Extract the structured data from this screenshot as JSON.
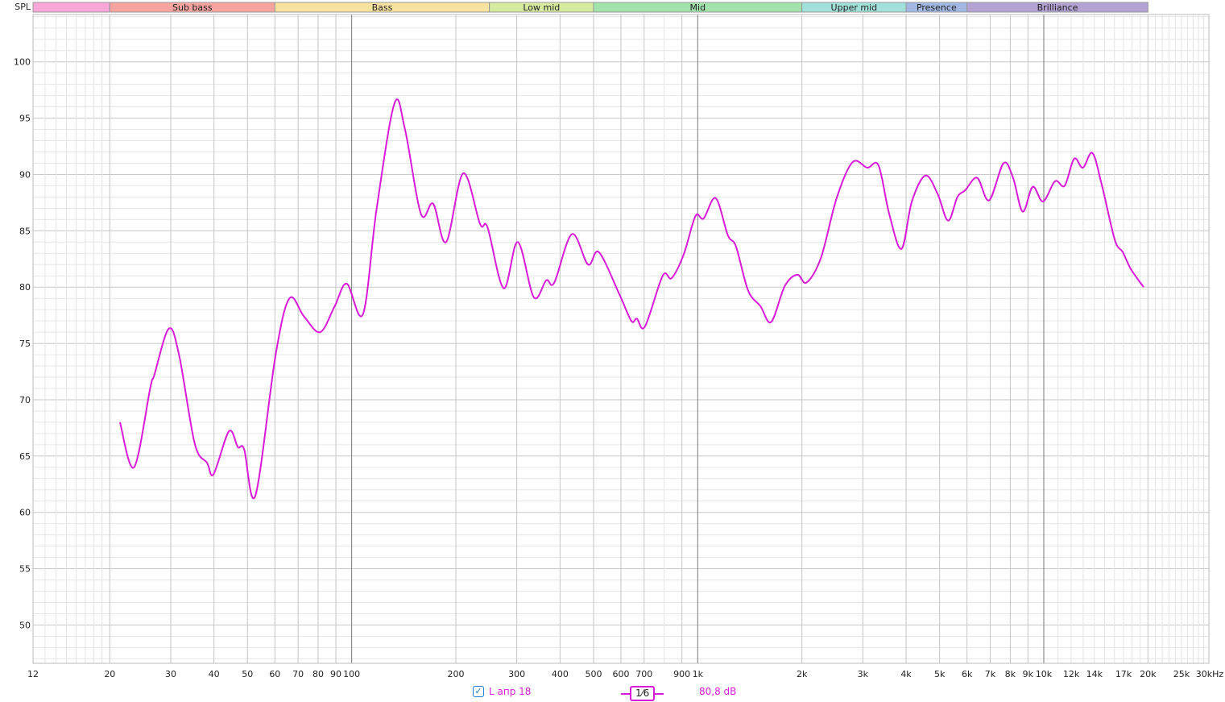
{
  "chart_data": {
    "type": "line",
    "ylabel": "SPL",
    "xscale": "log",
    "xlim": [
      12,
      30000
    ],
    "ylim": [
      46.6,
      104.2
    ],
    "yticks": [
      50,
      55,
      60,
      65,
      70,
      75,
      80,
      85,
      90,
      95,
      100
    ],
    "ygrid_minor_step": 1,
    "xticks": [
      {
        "f": 12,
        "label": "12"
      },
      {
        "f": 20,
        "label": "20"
      },
      {
        "f": 30,
        "label": "30"
      },
      {
        "f": 40,
        "label": "40"
      },
      {
        "f": 50,
        "label": "50"
      },
      {
        "f": 60,
        "label": "60"
      },
      {
        "f": 70,
        "label": "70"
      },
      {
        "f": 80,
        "label": "80"
      },
      {
        "f": 90,
        "label": "90"
      },
      {
        "f": 100,
        "label": "100"
      },
      {
        "f": 200,
        "label": "200"
      },
      {
        "f": 300,
        "label": "300"
      },
      {
        "f": 400,
        "label": "400"
      },
      {
        "f": 500,
        "label": "500"
      },
      {
        "f": 600,
        "label": "600"
      },
      {
        "f": 700,
        "label": "700"
      },
      {
        "f": 900,
        "label": "900"
      },
      {
        "f": 1000,
        "label": "1k"
      },
      {
        "f": 2000,
        "label": "2k"
      },
      {
        "f": 3000,
        "label": "3k"
      },
      {
        "f": 4000,
        "label": "4k"
      },
      {
        "f": 5000,
        "label": "5k"
      },
      {
        "f": 6000,
        "label": "6k"
      },
      {
        "f": 7000,
        "label": "7k"
      },
      {
        "f": 8000,
        "label": "8k"
      },
      {
        "f": 9000,
        "label": "9k"
      },
      {
        "f": 10000,
        "label": "10k"
      },
      {
        "f": 12000,
        "label": "12k",
        "minor": true
      },
      {
        "f": 14000,
        "label": "14k",
        "minor": true
      },
      {
        "f": 17000,
        "label": "17k",
        "minor": true
      },
      {
        "f": 20000,
        "label": "20k"
      },
      {
        "f": 25000,
        "label": "25k",
        "minor": true
      },
      {
        "f": 30000,
        "label": "30kHz"
      }
    ],
    "bands": [
      {
        "label": "",
        "from": 12,
        "to": 20,
        "color": "#f9a6d8"
      },
      {
        "label": "Sub bass",
        "from": 20,
        "to": 60,
        "color": "#f7a3a0"
      },
      {
        "label": "Bass",
        "from": 60,
        "to": 250,
        "color": "#f8e2a0"
      },
      {
        "label": "Low mid",
        "from": 250,
        "to": 500,
        "color": "#d6eba0"
      },
      {
        "label": "Mid",
        "from": 500,
        "to": 2000,
        "color": "#a2e2ac"
      },
      {
        "label": "Upper mid",
        "from": 2000,
        "to": 4000,
        "color": "#a2e0da"
      },
      {
        "label": "Presence",
        "from": 4000,
        "to": 6000,
        "color": "#a2b8e2"
      },
      {
        "label": "Brilliance",
        "from": 6000,
        "to": 20000,
        "color": "#b3a2d2"
      }
    ],
    "series": [
      {
        "name": "L апр 18",
        "color": "#d81bd8",
        "x": [
          21.4,
          23.5,
          26.2,
          26.9,
          29.6,
          31.7,
          35.2,
          38.2,
          39.9,
          44.2,
          46.9,
          48.9,
          52.7,
          60.3,
          66.1,
          72.8,
          81.1,
          89.3,
          96.8,
          107.8,
          118,
          132.9,
          142.6,
          158.6,
          172,
          187.5,
          210,
          235,
          247,
          275,
          302,
          336,
          365,
          385,
          433,
          482,
          518,
          593,
          643,
          667,
          704,
          792,
          841,
          911,
          985,
          1040,
          1127,
          1222,
          1290,
          1398,
          1518,
          1630,
          1785,
          1940,
          2063,
          2270,
          2520,
          2803,
          3090,
          3330,
          3575,
          3880,
          4157,
          4550,
          4930,
          5290,
          5630,
          5930,
          6420,
          6950,
          7650,
          8150,
          8690,
          9290,
          9950,
          10780,
          11490,
          12240,
          12970,
          13820,
          14730,
          16040,
          16920,
          17850,
          19430
        ],
        "y": [
          68.0,
          64.0,
          71.1,
          72.2,
          76.3,
          74.0,
          66.1,
          64.4,
          63.4,
          67.2,
          65.8,
          65.6,
          61.5,
          74.0,
          79.0,
          77.4,
          76.0,
          78.3,
          80.3,
          77.6,
          86.9,
          96.3,
          94.0,
          86.5,
          87.4,
          84.0,
          90.1,
          85.6,
          85.3,
          79.9,
          84.0,
          79.1,
          80.6,
          80.4,
          84.7,
          82.0,
          83.1,
          79.4,
          77.0,
          77.2,
          76.5,
          81.0,
          80.8,
          82.9,
          86.3,
          86.1,
          87.9,
          84.6,
          83.6,
          79.7,
          78.3,
          76.9,
          80.1,
          81.1,
          80.4,
          82.6,
          87.9,
          91.1,
          90.6,
          90.8,
          86.5,
          83.4,
          87.6,
          89.9,
          88.3,
          85.9,
          88.0,
          88.6,
          89.7,
          87.7,
          91.0,
          89.7,
          86.7,
          88.9,
          87.6,
          89.4,
          89.0,
          91.4,
          90.6,
          91.9,
          89.0,
          84.2,
          83.1,
          81.6,
          80.0
        ]
      }
    ]
  },
  "legend": {
    "checked": true,
    "series_label": "L апр 18",
    "smoothing": "1⁄6",
    "readout": "80,8 dB"
  }
}
